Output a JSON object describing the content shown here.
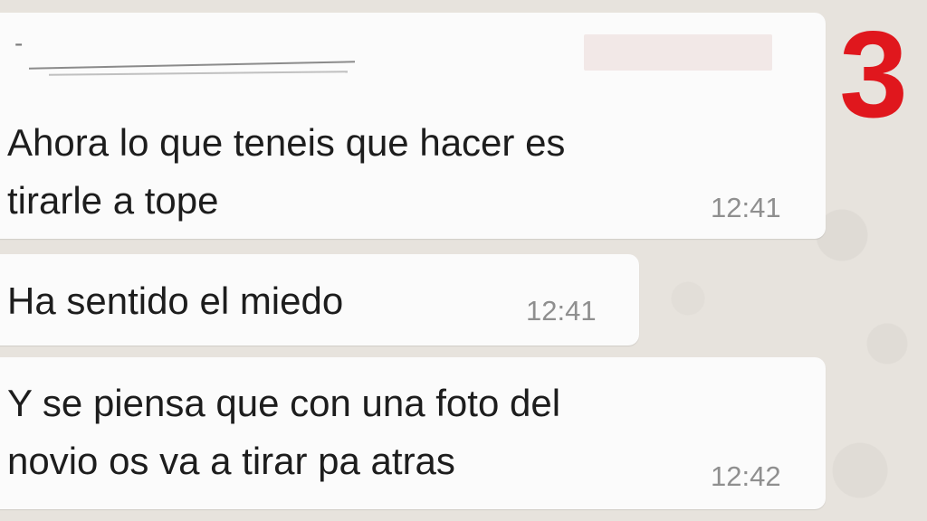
{
  "chat": {
    "messages": [
      {
        "sender": "- ",
        "text": "Ahora lo que teneis que hacer es\ntirarle a tope",
        "time": "12:41"
      },
      {
        "text": "Ha sentido el miedo",
        "time": "12:41"
      },
      {
        "text": "Y se piensa que con una foto del\nnovio os va a tirar pa atras",
        "time": "12:42"
      }
    ]
  },
  "overlay": {
    "step_number": "3",
    "step_color": "#e0171d"
  },
  "colors": {
    "bubble": "#fbfbfb",
    "background": "#e7e3dd",
    "timestamp": "#8f8f8f"
  }
}
